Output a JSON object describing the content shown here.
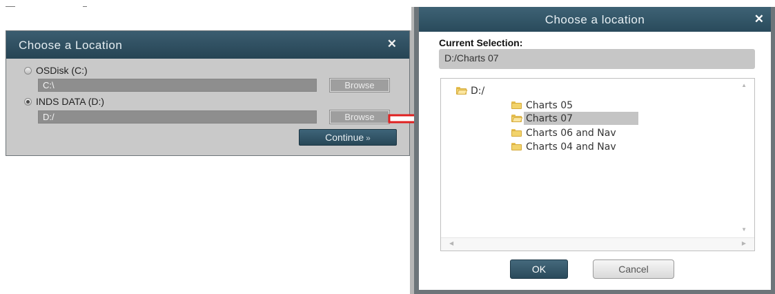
{
  "left_dialog": {
    "title": "Choose a Location",
    "close_glyph": "✕",
    "options": [
      {
        "label": "OSDisk (C:)",
        "path": "C:\\",
        "browse_label": "Browse",
        "selected": false
      },
      {
        "label": "INDS DATA (D:)",
        "path": "D:/",
        "browse_label": "Browse",
        "selected": true
      }
    ],
    "continue_label": "Continue",
    "continue_glyph": "»"
  },
  "right_dialog": {
    "title": "Choose a location",
    "close_glyph": "✕",
    "current_selection_label": "Current Selection:",
    "current_selection_value": "D:/Charts 07",
    "tree": {
      "root": "D:/",
      "children": [
        "Charts 05",
        "Charts 07",
        "Charts 06 and Nav",
        "Charts 04 and Nav"
      ],
      "selected": "Charts 07"
    },
    "ok_label": "OK",
    "cancel_label": "Cancel"
  },
  "colors": {
    "title_bar": "#294a5b",
    "annotation_arrow": "#e02020",
    "selection_highlight": "#c4c4c4"
  },
  "icons": [
    "close-icon",
    "folder-open-icon",
    "folder-icon",
    "scroll-arrow-icon",
    "arrow-annotation"
  ]
}
